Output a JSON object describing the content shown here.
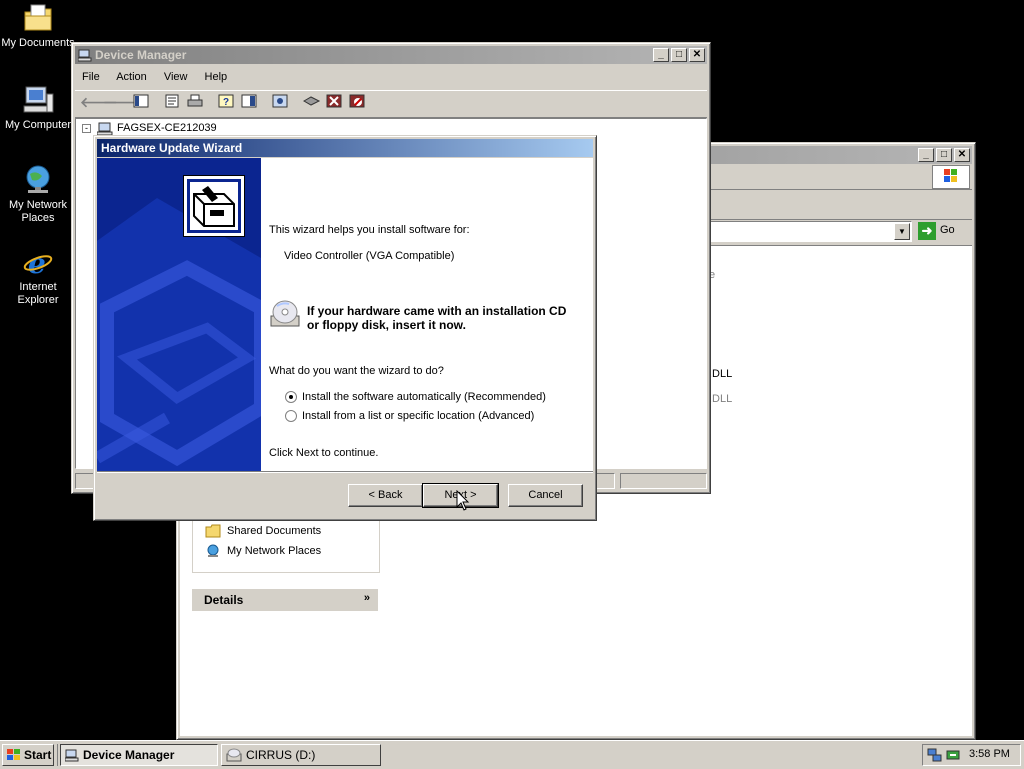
{
  "desktop": {
    "icons": [
      {
        "label": "My Documents",
        "icon": "my-documents-icon"
      },
      {
        "label": "My Computer",
        "icon": "my-computer-icon"
      },
      {
        "label": "My Network Places",
        "icon": "network-places-icon"
      },
      {
        "label": "Internet Explorer",
        "icon": "internet-explorer-icon"
      }
    ]
  },
  "explorer": {
    "go_label": "Go",
    "partial_items": [
      "e",
      ".DLL",
      ".DLL"
    ],
    "other_places": [
      "Shared Documents",
      "My Network Places"
    ],
    "details_label": "Details"
  },
  "device_manager": {
    "title": "Device Manager",
    "menu": [
      "File",
      "Action",
      "View",
      "Help"
    ],
    "tree_root": "FAGSEX-CE212039"
  },
  "wizard": {
    "title": "Hardware Update Wizard",
    "intro": "This wizard helps you install software for:",
    "device": "Video Controller (VGA Compatible)",
    "cd_notice_line1": "If your hardware came with an installation CD",
    "cd_notice_line2": "or floppy disk, insert it now.",
    "question": "What do you want the wizard to do?",
    "options": [
      {
        "label": "Install the software automatically (Recommended)",
        "selected": true
      },
      {
        "label": "Install from a list or specific location (Advanced)",
        "selected": false
      }
    ],
    "continue_text": "Click Next to continue.",
    "back_label": "< Back",
    "next_label": "Next >",
    "cancel_label": "Cancel"
  },
  "taskbar": {
    "start_label": "Start",
    "tasks": [
      {
        "label": "Device Manager",
        "active": true
      },
      {
        "label": "CIRRUS (D:)",
        "active": false
      }
    ],
    "clock": "3:58 PM"
  },
  "colors": {
    "active_title": "#0a246a",
    "desktop": "#000000",
    "window_face": "#d4d0c8"
  }
}
